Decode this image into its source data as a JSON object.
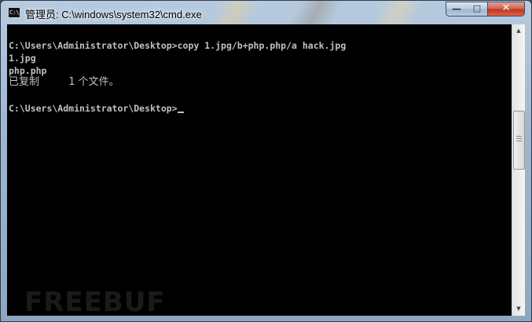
{
  "window": {
    "title": "管理员: C:\\windows\\system32\\cmd.exe",
    "icon": "cmd-icon",
    "icon_text": "C:\\"
  },
  "controls": {
    "minimize": "—",
    "maximize": "□",
    "close": "✕"
  },
  "console": {
    "lines": [
      "C:\\Users\\Administrator\\Desktop>copy 1.jpg/b+php.php/a hack.jpg",
      "1.jpg",
      "php.php",
      "已复制         1 个文件。",
      "",
      "C:\\Users\\Administrator\\Desktop>"
    ]
  },
  "watermark": "FREEBUF",
  "scrollbar": {
    "up": "▲",
    "down": "▼"
  }
}
